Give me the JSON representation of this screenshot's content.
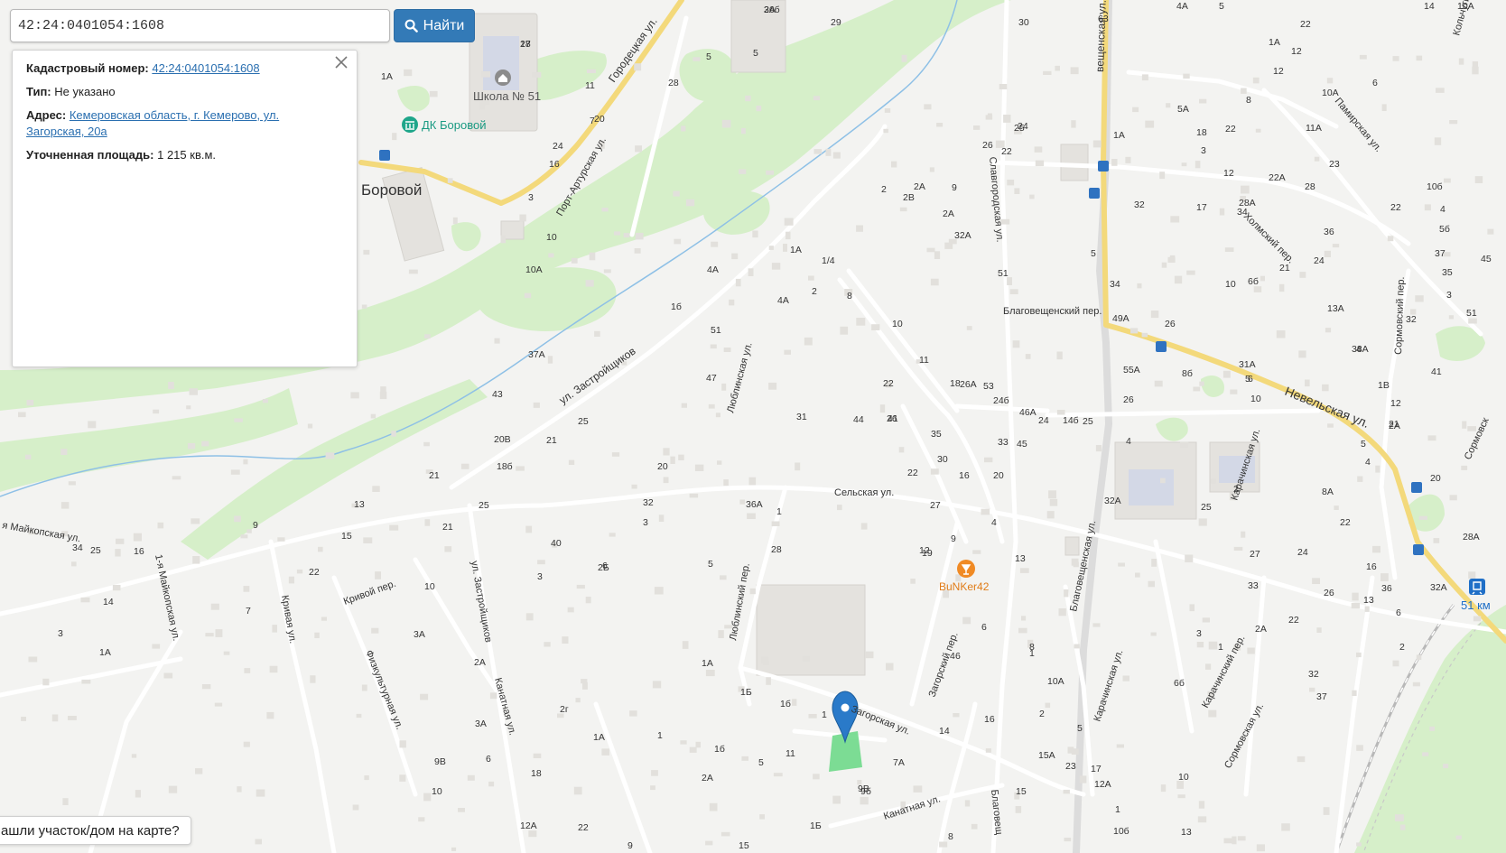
{
  "search": {
    "value": "42:24:0401054:1608",
    "button_label": "Найти",
    "button_icon": "search-icon"
  },
  "info": {
    "cadastral_label": "Кадастровый номер:",
    "cadastral_value": "42:24:0401054:1608",
    "type_label": "Тип:",
    "type_value": "Не указано",
    "address_label": "Адрес:",
    "address_line1": "Кемеровская область, г. Кемерово, ул.",
    "address_line2": "Загорская, 20а",
    "area_label": "Уточненная площадь:",
    "area_value": "1 215 кв.м."
  },
  "help_text": "ашли участок/дом на карте?",
  "map": {
    "pois": {
      "school": "Школа № 51",
      "dk": "ДК Боровой",
      "district": "Боровой",
      "bar": "BuNKer42",
      "station": "51 км"
    },
    "streets": {
      "gorodetskaya": "Городецкая ул.",
      "port_arthur": "Порт-Артурская ул.",
      "zastroyshchikov": "ул. Застройщиков",
      "zastroyshchikov2": "ул. Застройщиков",
      "lyublinskaya": "Люблинская ул.",
      "lyublinsky_per": "Люблинский пер.",
      "selskaya": "Сельская ул.",
      "zagorskaya": "Загорская ул.",
      "zagorsky_per": "Загорский пер.",
      "kanatnaya": "Канатная ул.",
      "kanatnaya2": "Канатная ул.",
      "slavgorodskaya": "Славгородская ул.",
      "blagoveshch_per": "Благовещенский пер.",
      "blagoveshch_ul": "Благовещенская ул.",
      "blagoveshch_top": "вещенская ул.",
      "blagoveshch_bottom": "Благовещ",
      "nevelskaya": "Невельская ул.",
      "kholmsky": "Холмский пер.",
      "pamirskaya": "Памирская ул.",
      "sormovsky": "Сормовский пер.",
      "sormovskaya": "Сормовская ул.",
      "sormovsk_edge": "Сормовск",
      "karachinskaya": "Карачинская ул.",
      "karachinskaya2": "Карачинская ул.",
      "karachinsky": "Карачинский пер.",
      "maikop1": "я Майкопская ул.",
      "maikop2": "1-я Майкопская ул.",
      "krivoy": "Кривой пер.",
      "krivaya": "Кривая ул.",
      "fizkult": "Физкультурная ул.",
      "kolchug": "Кольчуги"
    },
    "numbers": [
      "36б",
      "28",
      "5",
      "29",
      "30",
      "63",
      "4А",
      "5",
      "14",
      "12",
      "6",
      "10А",
      "1А",
      "5",
      "11",
      "28",
      "7",
      "20",
      "24",
      "16",
      "3",
      "10",
      "10А",
      "4А",
      "1б",
      "51",
      "47",
      "37А",
      "43",
      "25",
      "21",
      "20В",
      "20",
      "18б",
      "25",
      "21",
      "13",
      "9",
      "15",
      "22",
      "21",
      "34",
      "16",
      "25",
      "14",
      "7",
      "3",
      "1А",
      "10",
      "3А",
      "2А",
      "3А",
      "9В",
      "6",
      "10",
      "18",
      "12А",
      "22",
      "9",
      "15",
      "28",
      "32",
      "36А",
      "40",
      "3",
      "5",
      "6",
      "1",
      "3",
      "2Б",
      "1А",
      "1Б",
      "1б",
      "2г",
      "1А",
      "1",
      "1б",
      "2А",
      "5",
      "11",
      "1",
      "9В",
      "9б",
      "7А",
      "1Б",
      "1А",
      "1/4",
      "4А",
      "2",
      "8",
      "10",
      "11",
      "18",
      "22",
      "26",
      "44",
      "31",
      "41",
      "35",
      "22",
      "30",
      "33",
      "20",
      "16",
      "27",
      "19",
      "4",
      "9",
      "12",
      "13",
      "6",
      "8",
      "1",
      "10А",
      "2",
      "5",
      "15А",
      "15",
      "23",
      "17",
      "14",
      "16",
      "8",
      "1",
      "13",
      "12А",
      "10б",
      "10",
      "6",
      "4",
      "2",
      "2В",
      "2А",
      "9",
      "2А",
      "32А",
      "26",
      "25",
      "24",
      "22",
      "1А",
      "5",
      "51",
      "34",
      "49А",
      "55А",
      "26",
      "24б",
      "24",
      "25",
      "26А",
      "53",
      "46А",
      "45",
      "14б",
      "32А",
      "32",
      "28А",
      "26",
      "8б",
      "31А",
      "10",
      "5",
      "6",
      "4",
      "2",
      "25",
      "22",
      "12",
      "1А",
      "10А",
      "11А",
      "8",
      "22",
      "5А",
      "3",
      "18",
      "12",
      "17",
      "22А",
      "23",
      "28",
      "34",
      "36",
      "22",
      "24",
      "21",
      "10",
      "6б",
      "13А",
      "4",
      "12",
      "5",
      "1В",
      "2А",
      "21",
      "4",
      "10б",
      "5б",
      "35",
      "37",
      "38А",
      "3",
      "51",
      "45",
      "32",
      "41",
      "36",
      "32А",
      "28А",
      "4",
      "8А",
      "22",
      "16",
      "20",
      "24",
      "27",
      "33",
      "26",
      "22",
      "32",
      "37",
      "13",
      "6",
      "2",
      "2А",
      "1",
      "6б",
      "3",
      "2А",
      "17"
    ]
  }
}
